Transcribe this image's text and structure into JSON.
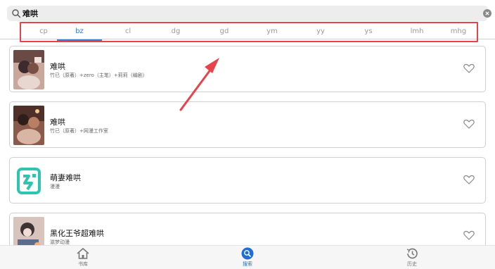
{
  "search": {
    "value": "难哄"
  },
  "tabs": [
    {
      "label": "cp"
    },
    {
      "label": "bz"
    },
    {
      "label": "cl"
    },
    {
      "label": "dg"
    },
    {
      "label": "gd"
    },
    {
      "label": "ym"
    },
    {
      "label": "yy"
    },
    {
      "label": "ys"
    },
    {
      "label": "lmh"
    },
    {
      "label": "mhg"
    }
  ],
  "active_tab": "bz",
  "results": [
    {
      "title": "难哄",
      "subtitle": "竹已（原著）+zero（主笔）+莉莉（编剧）",
      "favorite_icon": "heart-outline-icon"
    },
    {
      "title": "难哄",
      "subtitle": "竹已（原著）+网漫工作室",
      "favorite_icon": "heart-outline-icon"
    },
    {
      "title": "萌妻难哄",
      "subtitle": "漫漫",
      "favorite_icon": "heart-outline-icon"
    },
    {
      "title": "黑化王爷超难哄",
      "subtitle": "滋梦动漫",
      "favorite_icon": "heart-outline-icon"
    }
  ],
  "bottom_nav": [
    {
      "label": "书库",
      "icon": "home-icon"
    },
    {
      "label": "搜索",
      "icon": "search-icon"
    },
    {
      "label": "历史",
      "icon": "history-icon"
    }
  ],
  "colors": {
    "accent": "#2a7fd4",
    "highlight_box": "#e8434b",
    "app_logo": "#2ec4b0"
  }
}
